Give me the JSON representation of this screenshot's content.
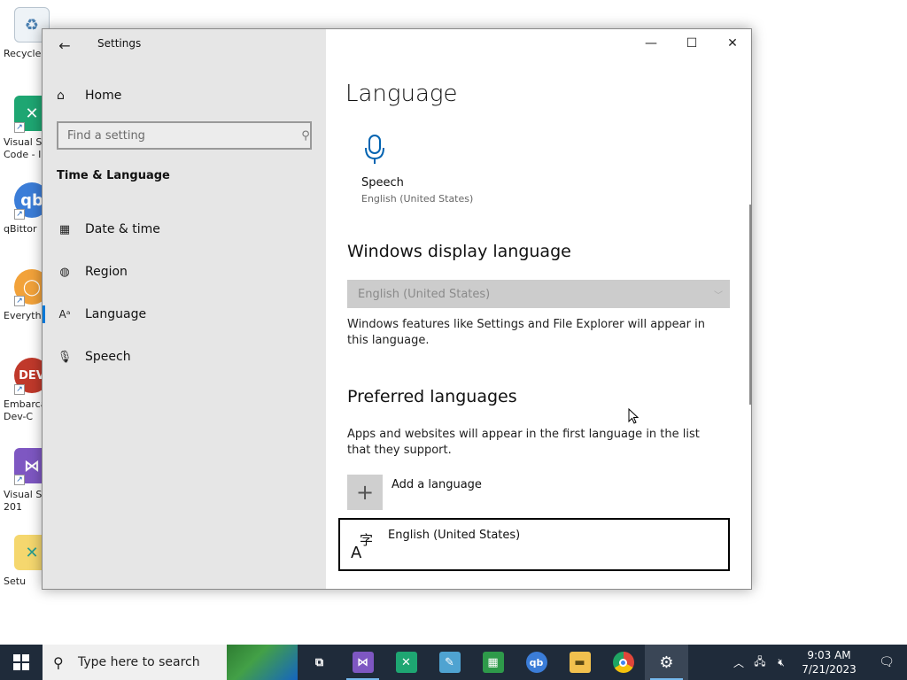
{
  "desktop": {
    "icons": [
      {
        "label": "Recycle",
        "color": "#ffffff"
      },
      {
        "label": "Visual S",
        "label2": "Code - I",
        "color": "#1ea672"
      },
      {
        "label": "qBittor",
        "color": "#3b7dd8"
      },
      {
        "label": "Everyth",
        "color": "#f2a23a"
      },
      {
        "label": "Embarca",
        "label2": "Dev-C",
        "color": "#c0392b"
      },
      {
        "label": "Visual S",
        "label2": "201",
        "color": "#7e57c2"
      },
      {
        "label": "Setu",
        "color": "#2a9d8f"
      }
    ]
  },
  "window": {
    "title": "Settings",
    "sidebar": {
      "home_label": "Home",
      "search_placeholder": "Find a setting",
      "section": "Time & Language",
      "items": [
        {
          "label": "Date & time",
          "icon": "calendar-clock-icon"
        },
        {
          "label": "Region",
          "icon": "globe-icon"
        },
        {
          "label": "Language",
          "icon": "language-icon"
        },
        {
          "label": "Speech",
          "icon": "microphone-icon"
        }
      ]
    },
    "content": {
      "title": "Language",
      "speech_tile": {
        "name": "Speech",
        "sub": "English (United States)"
      },
      "display_language": {
        "heading": "Windows display language",
        "selected": "English (United States)",
        "description": "Windows features like Settings and File Explorer will appear in this language."
      },
      "preferred": {
        "heading": "Preferred languages",
        "description": "Apps and websites will appear in the first language in the list that they support.",
        "add_label": "Add a language",
        "languages": [
          "English (United States)"
        ]
      }
    }
  },
  "taskbar": {
    "search_placeholder": "Type here to search",
    "time": "9:03 AM",
    "date": "7/21/2023",
    "apps": [
      {
        "name": "task-view-icon",
        "glyph": "⧉",
        "color": "transparent"
      },
      {
        "name": "visual-studio-icon",
        "glyph": "⋈",
        "color": "#7e57c2"
      },
      {
        "name": "vscode-icon",
        "glyph": "✕",
        "color": "#1ea672"
      },
      {
        "name": "notepad-icon",
        "glyph": "✎",
        "color": "#4fa3d1"
      },
      {
        "name": "spreadsheet-icon",
        "glyph": "▦",
        "color": "#2e9a4a"
      },
      {
        "name": "qbittorrent-icon",
        "glyph": "qb",
        "color": "#3b7dd8"
      },
      {
        "name": "file-explorer-icon",
        "glyph": "▬",
        "color": "#f2c14e"
      },
      {
        "name": "chrome-icon",
        "glyph": "◉",
        "color": "#e0463a"
      },
      {
        "name": "settings-icon",
        "glyph": "⚙",
        "color": "transparent"
      }
    ]
  },
  "colors": {
    "accent": "#0078d7",
    "taskbar": "#1f2b3a",
    "sidebar": "#e6e6e6"
  }
}
